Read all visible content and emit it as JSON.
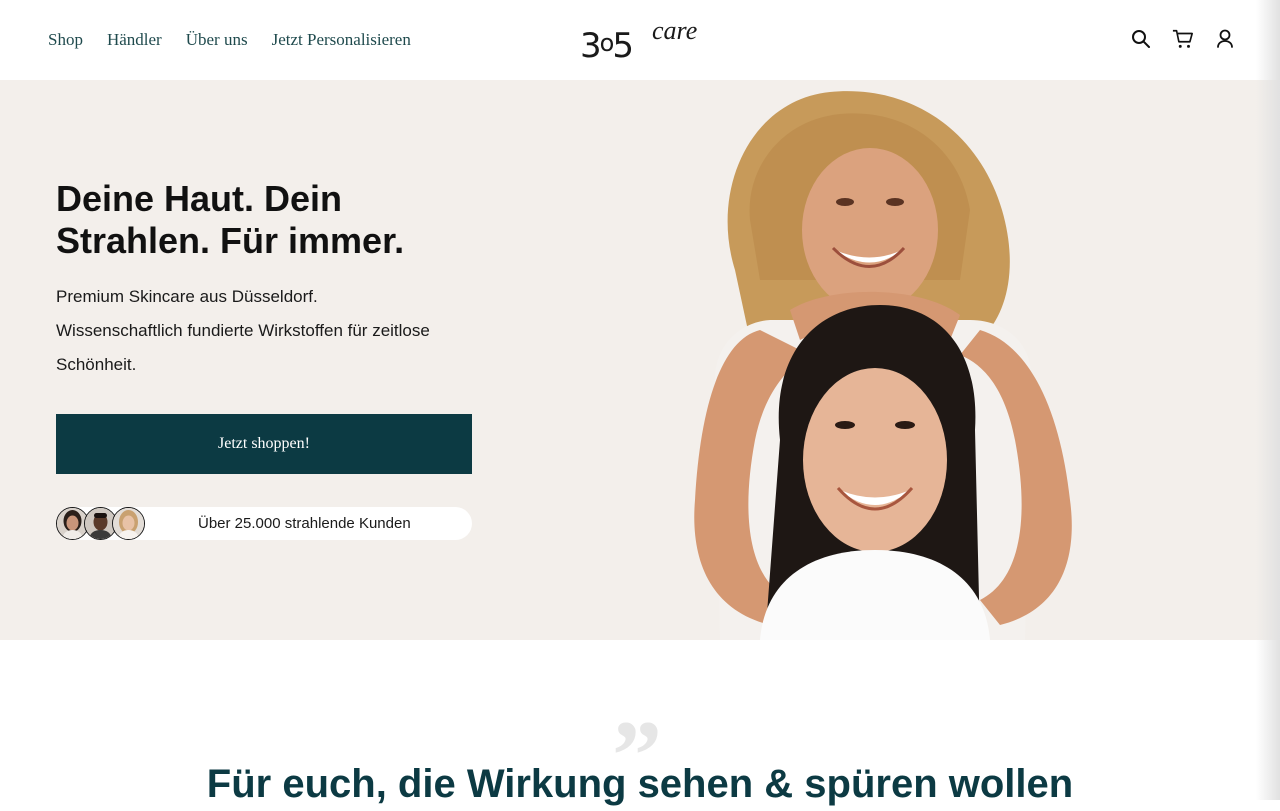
{
  "nav": {
    "items": [
      {
        "label": "Shop"
      },
      {
        "label": "Händler"
      },
      {
        "label": "Über uns"
      },
      {
        "label": "Jetzt Personalisieren"
      }
    ]
  },
  "logo": {
    "number": "3",
    "sup": "o",
    "number2": "5",
    "word": "care"
  },
  "header_icons": [
    "search-icon",
    "cart-icon",
    "user-icon"
  ],
  "hero": {
    "title_line1": "Deine Haut. Dein",
    "title_line2": "Strahlen. Für immer.",
    "subtitle_line1": "Premium Skincare aus Düsseldorf.",
    "subtitle_line2": "Wissenschaftlich fundierte Wirkstoffen für zeitlose",
    "subtitle_line3": "Schönheit.",
    "cta_label": "Jetzt shoppen!",
    "social_proof": "Über 25.000 strahlende Kunden"
  },
  "section": {
    "quote_glyph": "”",
    "title": "Für euch, die Wirkung sehen & spüren wollen"
  },
  "colors": {
    "accent": "#0c3a43",
    "nav_text": "#1f4a4d",
    "hero_bg": "#f3efeb"
  }
}
